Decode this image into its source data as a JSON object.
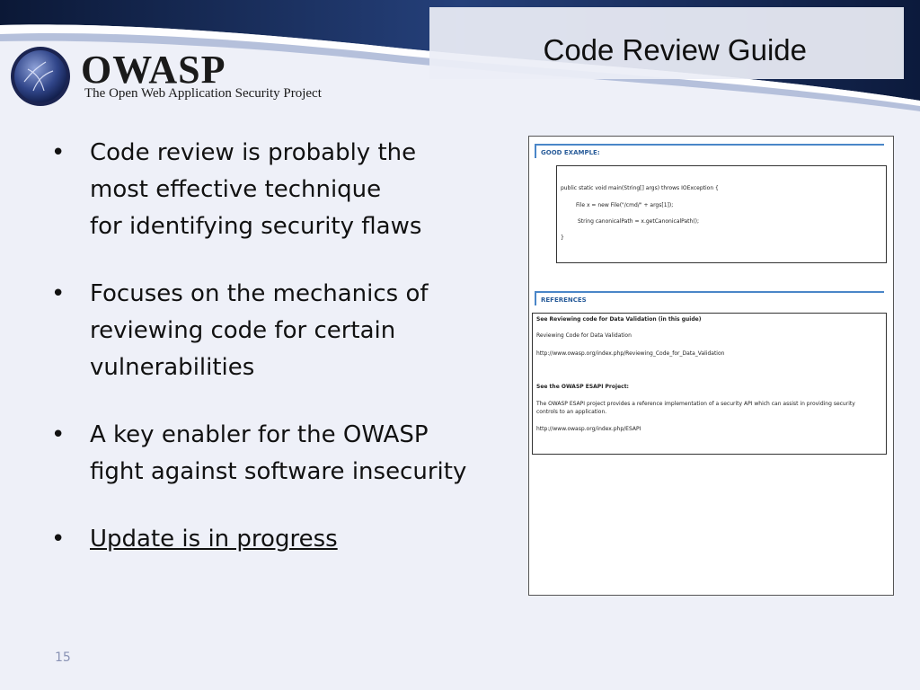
{
  "slide": {
    "title": "Code Review Guide",
    "page_number": "15"
  },
  "logo": {
    "wordmark": "OWASP",
    "tagline": "The Open Web Application Security Project"
  },
  "bullets": [
    {
      "text": "Code review is probably the\nmost effective technique\nfor identifying security flaws",
      "underlined": false
    },
    {
      "text": "Focuses on the mechanics of\nreviewing code for certain\nvulnerabilities",
      "underlined": false
    },
    {
      "text": "A key enabler for the OWASP\nfight against software insecurity",
      "underlined": false
    },
    {
      "text": "Update is in progress",
      "underlined": true
    }
  ],
  "bullet_glyph": "•",
  "document": {
    "good_example_heading": "GOOD EXAMPLE:",
    "code_lines": [
      "public static void main(String[] args) throws IOException {",
      "File x = new File(\"/cmd/\" + args[1]);",
      "String canonicalPath = x.getCanonicalPath();",
      "}"
    ],
    "references_heading": "REFERENCES",
    "references": {
      "line1": "See Reviewing code for Data Validation (in this guide)",
      "line2": "Reviewing Code for Data Validation",
      "line3": "http://www.owasp.org/index.php/Reviewing_Code_for_Data_Validation",
      "line4": "See the OWASP ESAPI Project:",
      "line5": "The OWASP ESAPI project provides a reference implementation of a security API which can assist in providing security controls to an application.",
      "line6": "http://www.owasp.org/index.php/ESAPI"
    }
  },
  "colors": {
    "header_dark": "#0d1a3a",
    "header_mid": "#2f4f8a",
    "accent_blue": "#4a86c8",
    "background": "#eef0f8"
  }
}
